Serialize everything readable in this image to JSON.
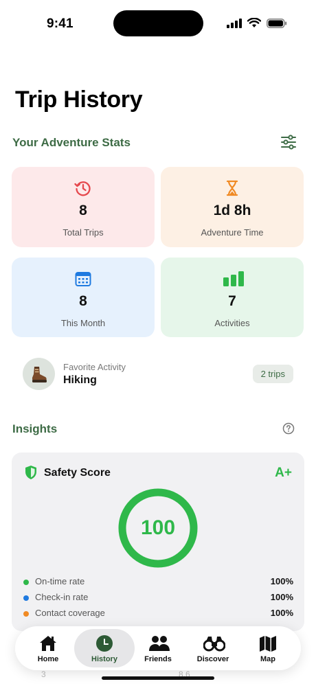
{
  "status_bar": {
    "time": "9:41"
  },
  "page": {
    "title": "Trip History"
  },
  "stats_section": {
    "title": "Your Adventure Stats"
  },
  "stats": [
    {
      "value": "8",
      "label": "Total Trips",
      "icon": "history-icon",
      "bg": "#fde9ea",
      "icon_color": "#e5484d"
    },
    {
      "value": "1d 8h",
      "label": "Adventure Time",
      "icon": "hourglass-icon",
      "bg": "#fdf0e4",
      "icon_color": "#f08a24"
    },
    {
      "value": "8",
      "label": "This Month",
      "icon": "calendar-icon",
      "bg": "#e6f1fd",
      "icon_color": "#1f7ae0"
    },
    {
      "value": "7",
      "label": "Activities",
      "icon": "bar-chart-icon",
      "bg": "#e6f6ea",
      "icon_color": "#2fb84a"
    }
  ],
  "favorite": {
    "subtitle": "Favorite Activity",
    "name": "Hiking",
    "badge": "2 trips",
    "icon": "hiking-boot-icon"
  },
  "insights": {
    "title": "Insights"
  },
  "safety": {
    "title": "Safety Score",
    "grade": "A+",
    "score": "100",
    "score_fraction": 1.0,
    "metrics": [
      {
        "name": "On-time rate",
        "value": "100%",
        "color": "#2fb84a"
      },
      {
        "name": "Check-in rate",
        "value": "100%",
        "color": "#1f7ae0"
      },
      {
        "name": "Contact coverage",
        "value": "100%",
        "color": "#f08a24"
      }
    ]
  },
  "tabbar": {
    "tabs": [
      {
        "label": "Home",
        "icon": "home-icon"
      },
      {
        "label": "History",
        "icon": "clock-icon",
        "active": true
      },
      {
        "label": "Friends",
        "icon": "people-icon"
      },
      {
        "label": "Discover",
        "icon": "binoculars-icon"
      },
      {
        "label": "Map",
        "icon": "map-icon"
      }
    ]
  },
  "underlay": {
    "left_value": "3",
    "right_value": "8.6"
  },
  "colors": {
    "accent_green": "#3d6b45",
    "success": "#2fb84a"
  }
}
